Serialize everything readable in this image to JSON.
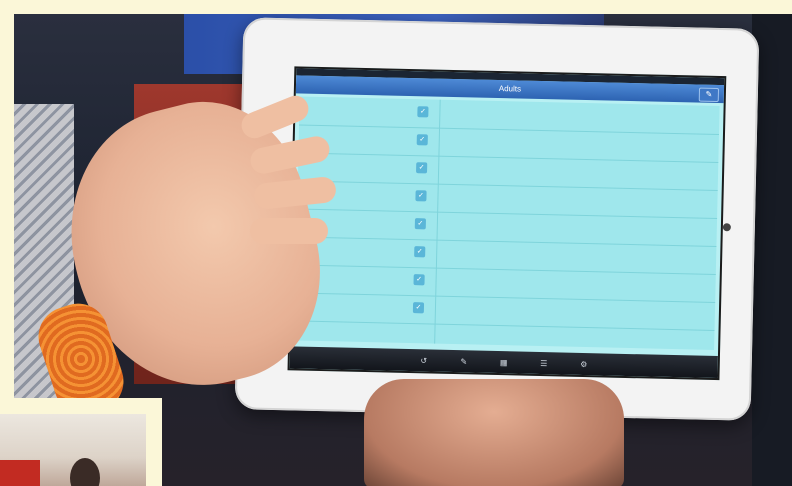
{
  "tablet_screen": {
    "title": "Adults",
    "edit_icon": "pencil-icon",
    "tab_icons": [
      "back-icon",
      "pencil-icon",
      "grid-icon",
      "list-icon",
      "settings-icon"
    ]
  },
  "colors": {
    "screen": "#b8f0f3",
    "title_bar": "#2d63b2",
    "frame": "#fbf7d8"
  }
}
